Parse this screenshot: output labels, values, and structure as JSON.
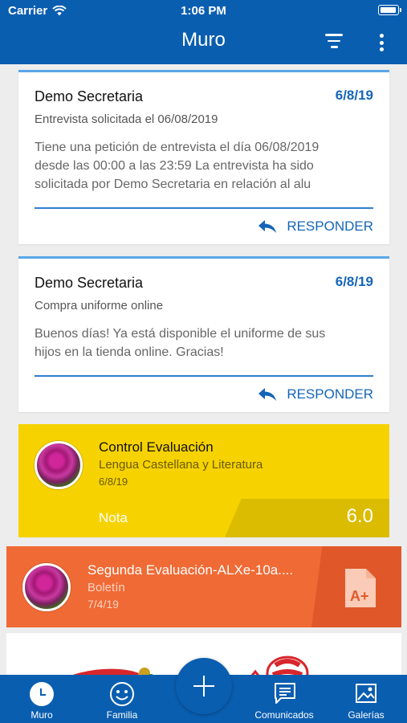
{
  "status_bar": {
    "carrier": "Carrier",
    "time": "1:06 PM"
  },
  "header": {
    "title": "Muro"
  },
  "feed": {
    "messages": [
      {
        "sender": "Demo Secretaria",
        "date": "6/8/19",
        "subject": "Entrevista solicitada el 06/08/2019",
        "body_lines": [
          "Tiene una petición de entrevista el día 06/08/2019",
          "desde las 00:00 a las 23:59 La entrevista ha sido",
          "solicitada por Demo Secretaria en relación al alu"
        ],
        "reply_label": "RESPONDER"
      },
      {
        "sender": "Demo Secretaria",
        "date": "6/8/19",
        "subject": "Compra uniforme online",
        "body_lines": [
          "Buenos días! Ya está disponible el uniforme de sus",
          "hijos en la tienda online. Gracias!"
        ],
        "reply_label": "RESPONDER"
      }
    ],
    "grade": {
      "title": "Control Evaluación",
      "subject": "Lengua Castellana y Literatura",
      "date": "6/8/19",
      "nota_label": "Nota",
      "nota_value": "6.0",
      "color": "#f6d200"
    },
    "report": {
      "title": "Segunda Evaluación-ALXe-10a....",
      "type": "Boletín",
      "date": "7/4/19",
      "icon": "document-a-plus-icon",
      "color": "#f06a35"
    }
  },
  "bottom_nav": {
    "items": [
      {
        "label": "Muro",
        "icon": "clock-icon"
      },
      {
        "label": "Familia",
        "icon": "smiley-icon"
      },
      {
        "label": "Comunicados",
        "icon": "chat-icon"
      },
      {
        "label": "Galerías",
        "icon": "gallery-icon"
      }
    ],
    "fab_icon": "plus-icon"
  },
  "colors": {
    "primary": "#0a5eb0",
    "accent": "#1565b8"
  }
}
